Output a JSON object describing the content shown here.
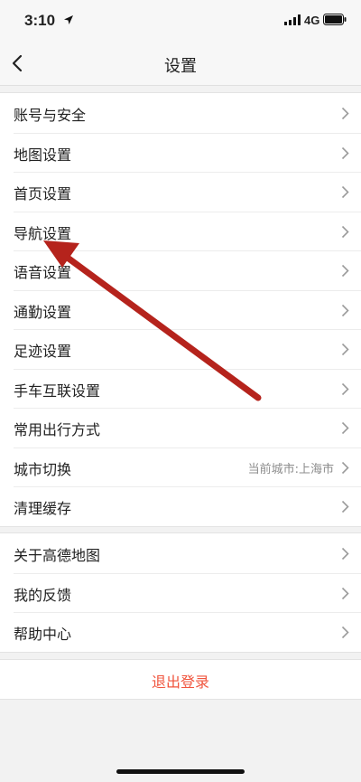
{
  "status_bar": {
    "time": "3:10",
    "network": "4G"
  },
  "nav": {
    "title": "设置",
    "back_icon": "chevron-left-icon"
  },
  "settings_group_1": [
    {
      "label": "账号与安全"
    },
    {
      "label": "地图设置"
    },
    {
      "label": "首页设置"
    },
    {
      "label": "导航设置"
    },
    {
      "label": "语音设置"
    },
    {
      "label": "通勤设置"
    },
    {
      "label": "足迹设置"
    },
    {
      "label": "手车互联设置"
    },
    {
      "label": "常用出行方式"
    },
    {
      "label": "城市切换",
      "value": "当前城市:上海市"
    },
    {
      "label": "清理缓存"
    }
  ],
  "settings_group_2": [
    {
      "label": "关于高德地图"
    },
    {
      "label": "我的反馈"
    },
    {
      "label": "帮助中心"
    }
  ],
  "logout": {
    "label": "退出登录"
  },
  "colors": {
    "accent_logout": "#f0553e",
    "annotation_arrow": "#b5231c",
    "background": "#f2f2f2"
  }
}
